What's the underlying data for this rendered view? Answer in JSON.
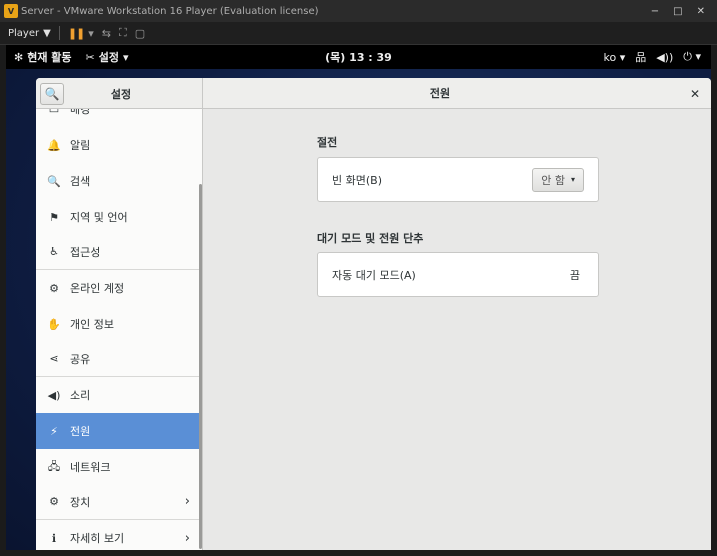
{
  "vm": {
    "title": "Server - VMware Workstation 16 Player (Evaluation license)",
    "logo_glyph": "V",
    "minimize_glyph": "−",
    "maximize_glyph": "□",
    "close_glyph": "✕",
    "player_label": "Player",
    "player_caret": "▼",
    "pause_glyph": "❚❚",
    "pause_caret": "▾",
    "send_keys_glyph": "⇆",
    "fullscreen_glyph": "⛶",
    "unity_glyph": "▢"
  },
  "gnome": {
    "activities_icon": "✻",
    "activities_label": "현재 활동",
    "app_icon": "✂",
    "app_label": "설정",
    "app_caret": "▾",
    "clock": "(목) 13 : 39",
    "input_method": "ko",
    "input_caret": "▾",
    "network_icon": "品",
    "volume_icon": "◀))",
    "power_icon": "⏻",
    "power_caret": "▾"
  },
  "settings": {
    "search_icon": "🔍",
    "left_title": "설정",
    "main_title": "전원",
    "close_glyph": "✕",
    "sidebar": [
      {
        "label": "배경",
        "icon": "▭",
        "chevron": ""
      },
      {
        "label": "알림",
        "icon": "🔔",
        "chevron": ""
      },
      {
        "label": "검색",
        "icon": "🔍",
        "chevron": ""
      },
      {
        "label": "지역 및 언어",
        "icon": "⚑",
        "chevron": ""
      },
      {
        "label": "접근성",
        "icon": "♿",
        "chevron": ""
      },
      {
        "label": "온라인 계정",
        "icon": "⚙",
        "chevron": ""
      },
      {
        "label": "개인 정보",
        "icon": "✋",
        "chevron": ""
      },
      {
        "label": "공유",
        "icon": "⋖",
        "chevron": ""
      },
      {
        "label": "소리",
        "icon": "◀)",
        "chevron": ""
      },
      {
        "label": "전원",
        "icon": "⚡",
        "chevron": ""
      },
      {
        "label": "네트워크",
        "icon": "🖧",
        "chevron": ""
      },
      {
        "label": "장치",
        "icon": "⚙",
        "chevron": "›"
      },
      {
        "label": "자세히 보기",
        "icon": "ℹ",
        "chevron": "›"
      }
    ],
    "selected_index": 9,
    "power": {
      "saving_title": "절전",
      "blank_screen_label": "빈 화면(B)",
      "blank_screen_value": "안 함",
      "blank_screen_caret": "▾",
      "suspend_title": "대기 모드 및 전원 단추",
      "auto_suspend_label": "자동 대기 모드(A)",
      "auto_suspend_value": "끔"
    }
  },
  "colors": {
    "selected": "#5a8fd6",
    "vm_pause": "#f0a030"
  }
}
